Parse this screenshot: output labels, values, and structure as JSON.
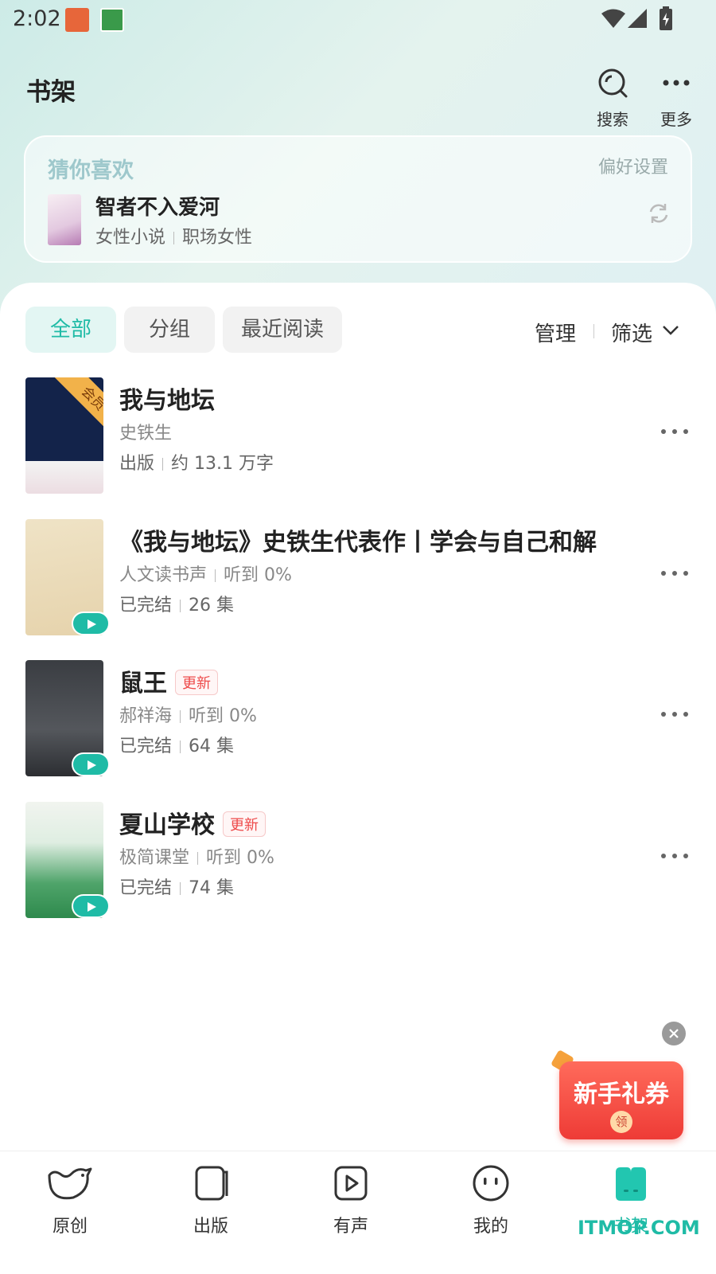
{
  "status_bar": {
    "time": "2:02"
  },
  "header": {
    "title": "书架",
    "search_label": "搜索",
    "more_label": "更多"
  },
  "recommend": {
    "title": "猜你喜欢",
    "preference_label": "偏好设置",
    "book_title": "智者不入爱河",
    "tag1": "女性小说",
    "tag2": "职场女性"
  },
  "tabs": {
    "all": "全部",
    "group": "分组",
    "recent": "最近阅读"
  },
  "tools": {
    "manage": "管理",
    "filter": "筛选"
  },
  "books": [
    {
      "title": "我与地坛",
      "author": "史铁生",
      "meta1": "出版",
      "meta2": "约 13.1 万字",
      "member_badge": "会员"
    },
    {
      "title": "《我与地坛》史铁生代表作丨学会与自己和解",
      "author": "人文读书声",
      "progress": "听到 0%",
      "status": "已完结",
      "episodes": "26 集"
    },
    {
      "title": "鼠王",
      "badge": "更新",
      "author": "郝祥海",
      "progress": "听到 0%",
      "status": "已完结",
      "episodes": "64 集"
    },
    {
      "title": "夏山学校",
      "badge": "更新",
      "author": "极简课堂",
      "progress": "听到 0%",
      "status": "已完结",
      "episodes": "74 集"
    }
  ],
  "coupon": {
    "text": "新手礼券",
    "claim": "领"
  },
  "bottom_nav": {
    "original": "原创",
    "publish": "出版",
    "audio": "有声",
    "mine": "我的",
    "shelf": "书架"
  },
  "watermark": "ITMOP.COM",
  "colors": {
    "accent": "#1fbba6",
    "update_red": "#ee4a4a",
    "coupon_red": "#ee3b36"
  }
}
